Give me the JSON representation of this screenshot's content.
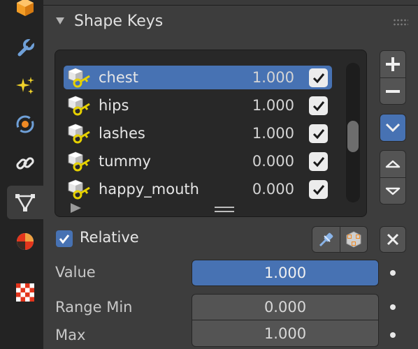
{
  "panel": {
    "title": "Shape Keys"
  },
  "tabs": [
    {
      "name": "object-tab",
      "icon": "orange-cube-icon"
    },
    {
      "name": "modifiers-tab",
      "icon": "wrench-icon"
    },
    {
      "name": "particles-tab",
      "icon": "sparkles-icon"
    },
    {
      "name": "physics-tab",
      "icon": "orbit-icon"
    },
    {
      "name": "constraints-tab",
      "icon": "chain-link-icon"
    },
    {
      "name": "object-data-tab",
      "icon": "mesh-triangle-icon",
      "active": true
    },
    {
      "name": "material-tab",
      "icon": "material-sphere-icon"
    },
    {
      "name": "texture-tab",
      "icon": "checker-icon"
    }
  ],
  "shape_keys": [
    {
      "name": "chest",
      "value": "1.000",
      "checked": true,
      "active": true
    },
    {
      "name": "hips",
      "value": "1.000",
      "checked": true
    },
    {
      "name": "lashes",
      "value": "1.000",
      "checked": true
    },
    {
      "name": "tummy",
      "value": "0.000",
      "checked": true
    },
    {
      "name": "happy_mouth",
      "value": "0.000",
      "checked": true
    }
  ],
  "relative": {
    "label": "Relative",
    "checked": true
  },
  "properties": {
    "value_label": "Value",
    "value": "1.000",
    "range_min_label": "Range Min",
    "range_min": "0.000",
    "max_label": "Max",
    "max": "1.000"
  },
  "colors": {
    "accent": "#4772b3",
    "panel": "#3d3d3d",
    "key_yellow": "#e6d100"
  }
}
